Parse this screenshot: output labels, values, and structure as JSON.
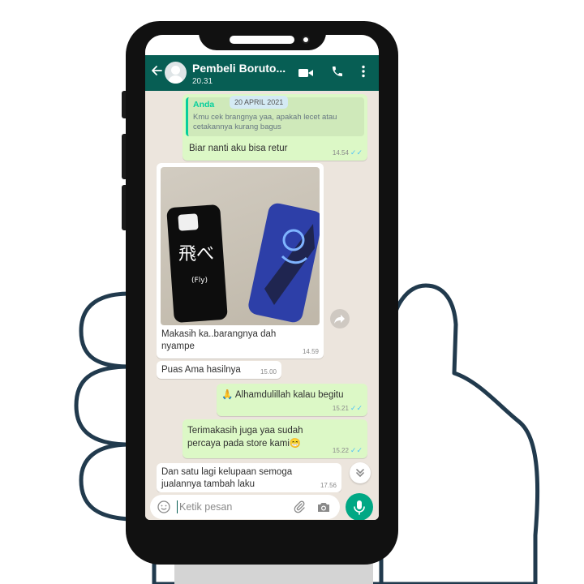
{
  "chat": {
    "contact_name": "Pembeli Boruto...",
    "last_seen": "20.31",
    "date_chip": "20 APRIL 2021",
    "quote_author": "Anda",
    "quote_text": "Kmu cek brangnya yaa, apakah lecet atau cetakannya kurang bagus",
    "messages": [
      {
        "text": "Biar nanti aku bisa retur",
        "time": "14.54",
        "dir": "out"
      },
      {
        "text": "Makasih ka..barangnya dah nyampe",
        "time": "14.59",
        "dir": "in",
        "photo": true
      },
      {
        "text": "Puas Ama hasilnya",
        "time": "15.00",
        "dir": "in"
      },
      {
        "text": "🙏 Alhamdulillah kalau begitu",
        "time": "15.21",
        "dir": "out"
      },
      {
        "text": "Terimakasih juga yaa sudah percaya pada store kami😁",
        "time": "15.22",
        "dir": "out"
      },
      {
        "text": "Dan satu lagi kelupaan semoga jualannya tambah laku",
        "time": "17.56",
        "dir": "in"
      }
    ]
  },
  "photo_text": {
    "case_left": "飛べ",
    "case_left_sub": "(Fly)"
  },
  "input": {
    "placeholder": "Ketik pesan"
  },
  "icons": {
    "back": "arrow-left-icon",
    "video": "video-camera-icon",
    "call": "phone-icon",
    "menu": "more-vert-icon",
    "emoji": "emoji-icon",
    "attach": "paperclip-icon",
    "camera": "camera-icon",
    "mic": "microphone-icon",
    "forward": "forward-icon",
    "scroll": "double-chevron-down-icon",
    "read": "double-check-icon"
  },
  "colors": {
    "header": "#075e54",
    "outgoing_bubble": "#dcf8c6",
    "incoming_bubble": "#ffffff",
    "chat_bg": "#ece5dd",
    "accent": "#00a884",
    "read_ticks": "#4fc3f7"
  }
}
